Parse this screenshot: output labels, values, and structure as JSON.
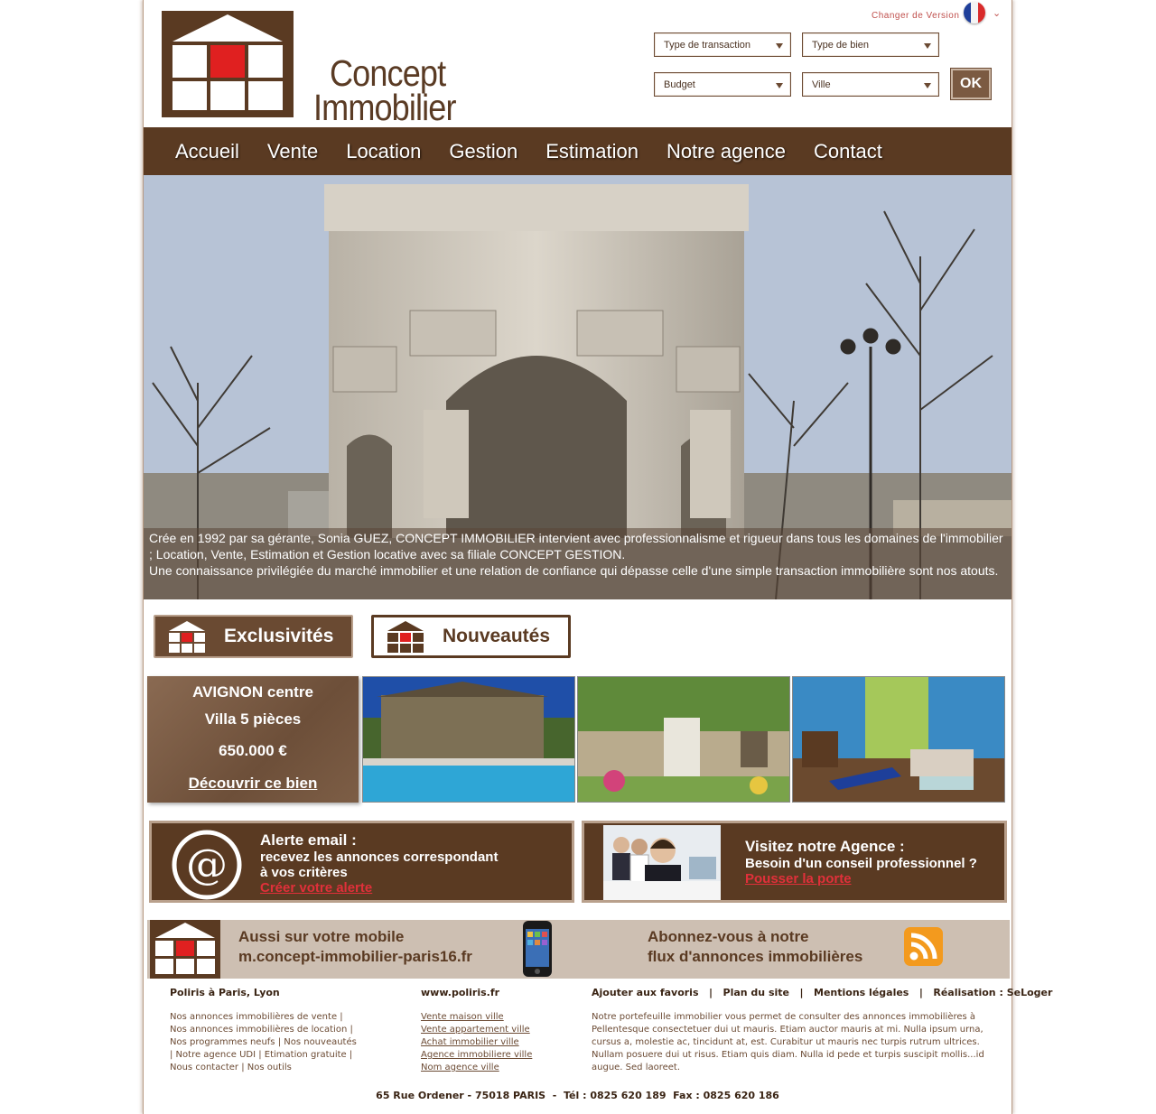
{
  "header": {
    "logo_line1": "Concept",
    "logo_line2": "Immobilier",
    "change_version": "Changer de Version",
    "search": {
      "transaction": "Type de transaction",
      "property": "Type de bien",
      "budget": "Budget",
      "city": "Ville",
      "submit": "OK"
    }
  },
  "nav": [
    "Accueil",
    "Vente",
    "Location",
    "Gestion",
    "Estimation",
    "Notre agence",
    "Contact"
  ],
  "hero": {
    "line1": "Crée en 1992 par sa gérante, Sonia GUEZ, CONCEPT IMMOBILIER intervient avec professionnalisme et rigueur dans tous les domaines de l'immobilier ; Location, Vente, Estimation et Gestion locative avec sa filiale CONCEPT GESTION.",
    "line2": "Une connaissance privilégiée du marché immobilier et une relation de confiance qui dépasse celle d'une simple transaction immobilière sont nos atouts."
  },
  "tabs": {
    "exclusivites": "Exclusivités",
    "nouveautes": "Nouveautés"
  },
  "featured": {
    "city": "AVIGNON centre",
    "type": "Villa 5 pièces",
    "price": "650.000 €",
    "cta": "Découvrir ce bien"
  },
  "promo_email": {
    "title": "Alerte email :",
    "line1": "recevez les annonces correspondant",
    "line2": "à vos critères",
    "link": "Créer votre alerte"
  },
  "promo_agency": {
    "title": "Visitez notre Agence :",
    "line1": "Besoin d'un conseil professionnel ?",
    "link": "Pousser la porte"
  },
  "band": {
    "mobile_line1": "Aussi sur votre  mobile",
    "mobile_line2": "m.concept-immobilier-paris16.fr",
    "rss_line1": "Abonnez-vous à notre",
    "rss_line2": "flux d'annonces immobilières"
  },
  "footer": {
    "col1_title": "Poliris à Paris, Lyon",
    "col1_lines": [
      "Nos annonces immobilières de vente |",
      "Nos annonces immobilières de location |",
      "Nos programmes neufs | Nos nouveautés",
      "| Notre agence UDI | Etimation gratuite |",
      "Nous contacter | Nos outils"
    ],
    "col2_title": "www.poliris.fr",
    "col2_links": [
      "Vente maison ville",
      "Vente appartement ville",
      "Achat immobilier ville",
      "Agence immobiliere ville",
      "Nom agence ville"
    ],
    "col3_links": [
      "Ajouter aux favoris",
      "Plan du site",
      "Mentions légales",
      "Réalisation : SeLoger"
    ],
    "col3_text": "Notre portefeuille immobilier vous permet de consulter des annonces immobilières à Pellentesque consectetuer dui ut mauris. Etiam auctor mauris at mi. Nulla ipsum urna, cursus a, molestie ac, tincidunt at, est. Curabitur ut mauris nec turpis rutrum ultrices. Nullam posuere dui ut risus. Etiam quis diam. Nulla id pede et turpis suscipit mollis...id augue. Sed laoreet.",
    "address": "65 Rue Ordener - 75018 PARIS  -  Tél : 0825 620 189  Fax : 0825 620 186"
  },
  "colors": {
    "brand_brown": "#5a3a22",
    "accent_red": "#e0303a",
    "logo_red": "#e02020"
  }
}
